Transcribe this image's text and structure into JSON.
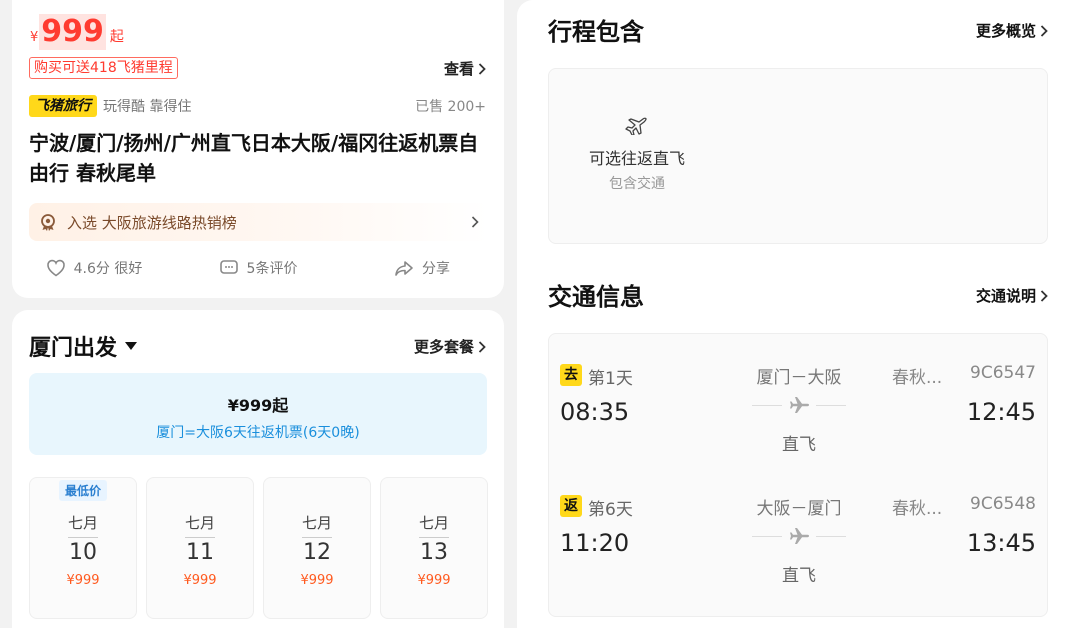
{
  "top_card": {
    "price_currency": "¥",
    "price_amount": "999",
    "price_unit": "起",
    "promo_tag": "购买可送418飞猪里程",
    "view_link": "查看",
    "brand_name": "飞猪旅行",
    "brand_slogan": "玩得酷 靠得住",
    "sold": "已售 200+",
    "title": "宁波/厦门/扬州/广州直飞日本大阪/福冈往返机票自由行 春秋尾单",
    "rank_text": "入选 大阪旅游线路热销榜",
    "rating": "4.6分 很好",
    "reviews": "5条评价",
    "share": "分享"
  },
  "package": {
    "departure": "厦门出发",
    "more_packages": "更多套餐",
    "selected_price": "¥999起",
    "selected_desc": "厦门=大阪6天往返机票(6天0晚)",
    "lowest_tag": "最低价",
    "dates": [
      {
        "month": "七月",
        "day": "10",
        "price": "¥999"
      },
      {
        "month": "七月",
        "day": "11",
        "price": "¥999"
      },
      {
        "month": "七月",
        "day": "12",
        "price": "¥999"
      },
      {
        "month": "七月",
        "day": "13",
        "price": "¥999"
      }
    ]
  },
  "itinerary": {
    "title": "行程包含",
    "more_link": "更多概览",
    "item_title": "可选往返直飞",
    "item_sub": "包含交通"
  },
  "transport": {
    "title": "交通信息",
    "link": "交通说明",
    "segments": [
      {
        "badge": "去",
        "day": "第1天",
        "dep_time": "08:35",
        "route": "厦门－大阪",
        "direct": "直飞",
        "airline": "春秋...",
        "flight_no": "9C6547",
        "arr_time": "12:45"
      },
      {
        "badge": "返",
        "day": "第6天",
        "dep_time": "11:20",
        "route": "大阪－厦门",
        "direct": "直飞",
        "airline": "春秋...",
        "flight_no": "9C6548",
        "arr_time": "13:45"
      }
    ]
  },
  "colors": {
    "accent_red": "#ff3b30",
    "brand_yellow": "#ffd81a",
    "info_blue": "#1a8fdc",
    "price_orange": "#ff5a1f"
  },
  "icons": {
    "chevron": "chevron-right-icon",
    "rank": "medal-icon",
    "rating": "heart-icon",
    "reviews": "comment-icon",
    "share": "share-icon",
    "plane": "plane-icon",
    "caret": "caret-down-icon"
  }
}
